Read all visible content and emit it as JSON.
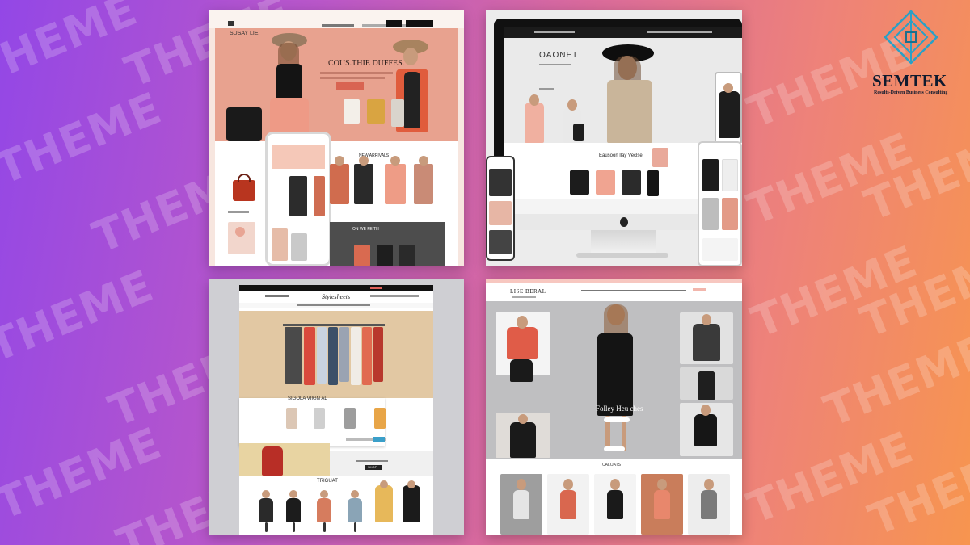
{
  "watermark": {
    "word": "THEME"
  },
  "brand": {
    "name": "SEMTEK",
    "tagline": "Results-Driven Business Consulting",
    "accent_color": "#2aa0c6"
  },
  "panel1": {
    "logo": "SUSAY LIE",
    "hero_title": "COUS.THIE DUFFES.",
    "cta": "SHOP NOW",
    "section_title": "NEW ARRIVALS",
    "promo_text": "ON WE FE TH"
  },
  "panel2": {
    "hero_title": "OAONET",
    "section_title": "Eausoorl llay Veclse",
    "device_logo": "apple-logo"
  },
  "panel3": {
    "logo": "Stylesheets",
    "section_title": "SIGOLA VIIGN AL",
    "button": "SHOP",
    "bottom_title": "TRIGUAT"
  },
  "panel4": {
    "logo": "LISE BERAL",
    "hero_title": "Folley Heu ches",
    "cta": "SHOP NOW",
    "section_title": "CALOATS"
  }
}
